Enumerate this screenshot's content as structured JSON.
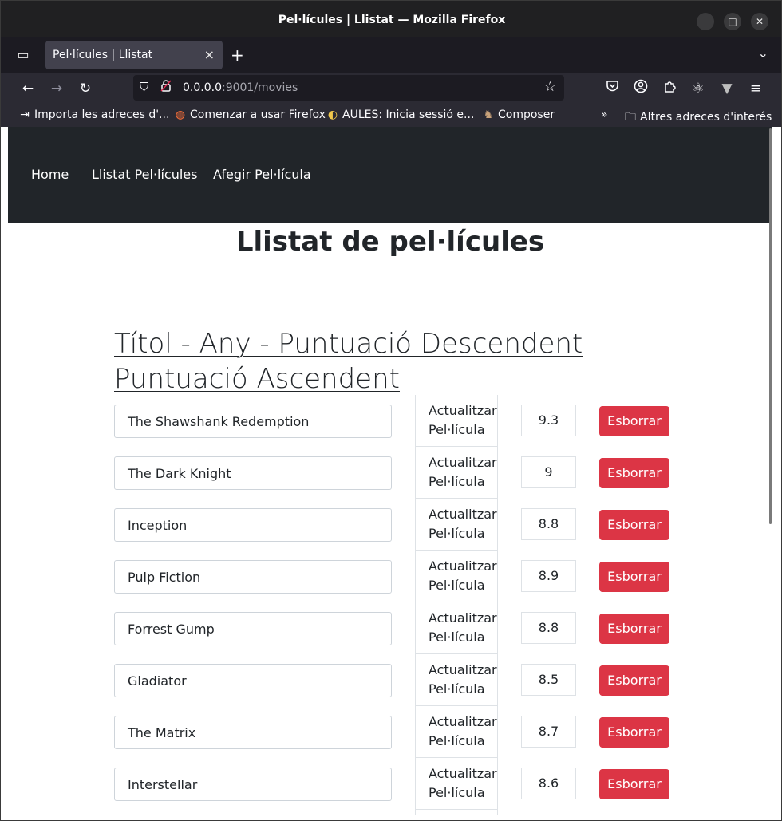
{
  "window": {
    "title": "Pel·lícules | Llistat — Mozilla Firefox",
    "controls": {
      "minimize": "–",
      "maximize": "□",
      "close": "✕"
    }
  },
  "tabs": {
    "active_label": "Pel·lícules | Llistat",
    "close": "×",
    "new_tab": "+",
    "list_menu": "⌄",
    "view_icon": "▭"
  },
  "toolbar": {
    "back": "←",
    "forward": "→",
    "reload": "↻",
    "url_host": "0.0.0.0",
    "url_rest": ":9001/movies",
    "shield": "⛉",
    "lock": "🔒",
    "bookmark_star": "☆",
    "pocket": "♡",
    "account": "◉",
    "extensions": "⧉",
    "react": "⚛",
    "vue": "▼",
    "menu": "≡"
  },
  "bookmarks": {
    "items": [
      {
        "icon": "⇥",
        "label": "Importa les adreces d'..."
      },
      {
        "icon": "◍",
        "label": "Comenzar a usar Firefox"
      },
      {
        "icon": "◐",
        "label": "AULES: Inicia sessió e..."
      },
      {
        "icon": "♞",
        "label": "Composer"
      }
    ],
    "overflow": "»",
    "folder_icon": "🗀",
    "folder_label": "Altres adreces d'interés"
  },
  "site_nav": {
    "home": "Home",
    "list": "Llistat Pel·lícules",
    "add": "Afegir Pel·lícula"
  },
  "main": {
    "title": "Llistat de pel·lícules",
    "sort_desc": "Títol - Any - Puntuació Descendent",
    "sort_asc": "Puntuació Ascendent",
    "update_label_line1": "Actualitzar",
    "update_label_line2": "Pel·lícula",
    "delete_label": "Esborrar",
    "movies": [
      {
        "title": "The Shawshank Redemption",
        "score": "9.3"
      },
      {
        "title": "The Dark Knight",
        "score": "9"
      },
      {
        "title": "Inception",
        "score": "8.8"
      },
      {
        "title": "Pulp Fiction",
        "score": "8.9"
      },
      {
        "title": "Forrest Gump",
        "score": "8.8"
      },
      {
        "title": "Gladiator",
        "score": "8.5"
      },
      {
        "title": "The Matrix",
        "score": "8.7"
      },
      {
        "title": "Interstellar",
        "score": "8.6"
      },
      {
        "title": "",
        "score": ""
      }
    ]
  },
  "colors": {
    "nav_bg": "#212529",
    "delete_button": "#dc3545",
    "browser_chrome": "#2b2a33"
  }
}
